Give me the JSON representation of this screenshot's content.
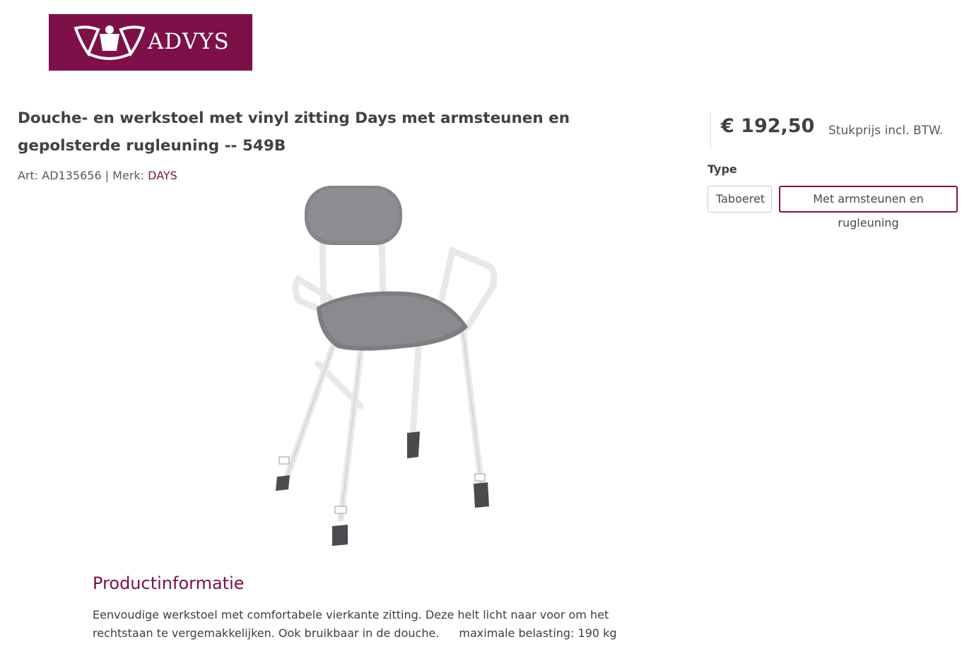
{
  "brand": {
    "logo_text": "ADVYS",
    "logo_color": "#7d1049"
  },
  "product": {
    "title": "Douche- en werkstoel met vinyl zitting Days met armsteunen en gepolsterde rugleuning -- 549B",
    "art_label": "Art: AD135656 | Merk: ",
    "brand_name": "DAYS",
    "image_icon": "chair-image"
  },
  "pricing": {
    "price": "€ 192,50",
    "unit_note": "Stukprijs incl. BTW."
  },
  "type": {
    "label": "Type",
    "options": [
      "Taboeret",
      "Met armsteunen en rugleuning"
    ],
    "selected": "Met armsteunen en rugleuning"
  },
  "info": {
    "heading": "Productinformatie",
    "text_1": "Eenvoudige werkstoel met comfortabele vierkante zitting. Deze helt licht naar voor om het rechtstaan te vergemakkelijken. Ook bruikbaar in de douche.",
    "text_2": "maximale belasting: 190 kg"
  },
  "colors": {
    "accent": "#7d1049",
    "text": "#3d4247"
  }
}
